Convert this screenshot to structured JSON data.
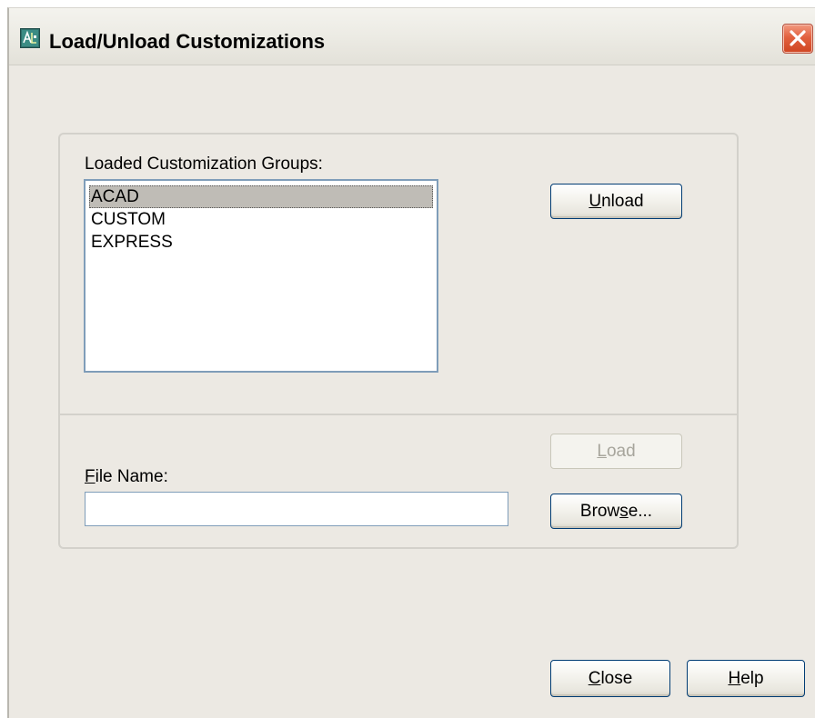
{
  "window": {
    "title": "Load/Unload Customizations",
    "close_symbol": "✕"
  },
  "groups_section": {
    "label": "Loaded Customization Groups:",
    "items": [
      "ACAD",
      "CUSTOM",
      "EXPRESS"
    ],
    "selected_index": 0,
    "unload_button": {
      "mnemonic": "U",
      "rest": "nload"
    }
  },
  "file_section": {
    "label_mnemonic": "F",
    "label_rest": "ile Name:",
    "file_name_value": "",
    "load_button": {
      "mnemonic": "L",
      "rest": "oad",
      "disabled": true
    },
    "browse_button": {
      "before": "Brow",
      "mnemonic": "s",
      "after": "e..."
    }
  },
  "footer": {
    "close_button": {
      "mnemonic": "C",
      "rest": "lose"
    },
    "help_button": {
      "mnemonic": "H",
      "rest": "elp"
    }
  },
  "colors": {
    "dialog_bg": "#ece9e3",
    "selection_bg": "#bfbcb6",
    "button_border": "#003c74",
    "close_button_red": "#e2613f"
  },
  "icons": {
    "app": "autocad-app-icon",
    "close": "close-icon"
  }
}
